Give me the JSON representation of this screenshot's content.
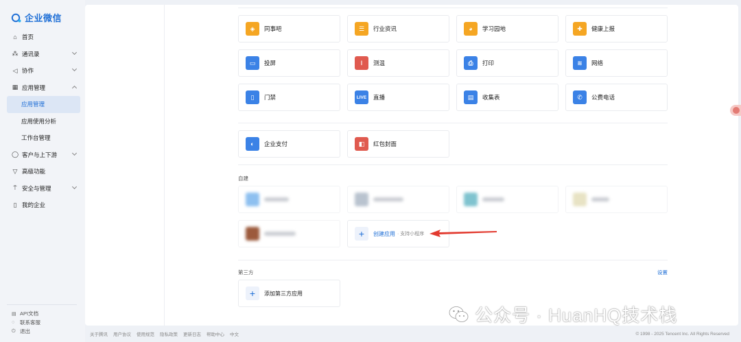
{
  "brand": {
    "name": "企业微信"
  },
  "sidebar": {
    "items": [
      {
        "label": "首页",
        "icon": "home-icon",
        "glyph": "⌂"
      },
      {
        "label": "通讯录",
        "icon": "contacts-icon",
        "glyph": "⁂",
        "expandable": true
      },
      {
        "label": "协作",
        "icon": "collab-icon",
        "glyph": "◁",
        "expandable": true
      },
      {
        "label": "应用管理",
        "icon": "apps-icon",
        "glyph": "▦",
        "expanded": true
      },
      {
        "label": "应用管理",
        "sub": true,
        "active": true
      },
      {
        "label": "应用使用分析",
        "sub": true
      },
      {
        "label": "工作台管理",
        "sub": true
      },
      {
        "label": "客户与上下游",
        "icon": "customer-icon",
        "glyph": "◯",
        "expandable": true
      },
      {
        "label": "高级功能",
        "icon": "advanced-icon",
        "glyph": "▽"
      },
      {
        "label": "安全与管理",
        "icon": "security-icon",
        "glyph": "⍑",
        "expandable": true
      },
      {
        "label": "我的企业",
        "icon": "enterprise-icon",
        "glyph": "▯"
      }
    ],
    "bottom_links": [
      {
        "label": "API文档",
        "icon": "doc-icon",
        "glyph": "▤"
      },
      {
        "label": "联系客服",
        "icon": "support-icon",
        "glyph": "◌"
      },
      {
        "label": "退出",
        "icon": "logout-icon",
        "glyph": "⏻"
      }
    ]
  },
  "apps": {
    "row1": [
      {
        "label": "同事吧",
        "icon": "colleague-icon",
        "color": "#f5a623",
        "glyph": "◈"
      },
      {
        "label": "行业资讯",
        "icon": "news-icon",
        "color": "#f5a623",
        "glyph": "☰"
      },
      {
        "label": "学习园地",
        "icon": "learning-icon",
        "color": "#f5a623",
        "glyph": "◕"
      },
      {
        "label": "健康上报",
        "icon": "health-icon",
        "color": "#f5a623",
        "glyph": "✚"
      }
    ],
    "row2": [
      {
        "label": "投屏",
        "icon": "screencast-icon",
        "color": "#3b82e6",
        "glyph": "▭"
      },
      {
        "label": "测温",
        "icon": "thermometer-icon",
        "color": "#e05a4f",
        "glyph": "ǀ"
      },
      {
        "label": "打印",
        "icon": "printer-icon",
        "color": "#3b82e6",
        "glyph": "⎙"
      },
      {
        "label": "网络",
        "icon": "wifi-icon",
        "color": "#3b82e6",
        "glyph": "≋"
      }
    ],
    "row3": [
      {
        "label": "门禁",
        "icon": "door-icon",
        "color": "#3b82e6",
        "glyph": "▯"
      },
      {
        "label": "直播",
        "icon": "live-icon",
        "color": "#3b82e6",
        "glyph": "LIVE"
      },
      {
        "label": "收集表",
        "icon": "form-icon",
        "color": "#3b82e6",
        "glyph": "▤"
      },
      {
        "label": "公费电话",
        "icon": "phone-icon",
        "color": "#3b82e6",
        "glyph": "✆"
      }
    ],
    "row4": [
      {
        "label": "企业支付",
        "icon": "payment-icon",
        "color": "#3b82e6",
        "glyph": "◐"
      },
      {
        "label": "红包封面",
        "icon": "redpacket-icon",
        "color": "#e05a4f",
        "glyph": "◧"
      }
    ]
  },
  "self_built": {
    "title": "自建",
    "create": {
      "label": "创建应用",
      "sub": "· 支持小程序"
    }
  },
  "third_party": {
    "title": "第三方",
    "settings": "设置",
    "add_label": "添加第三方应用"
  },
  "footer": {
    "links": [
      "关于腾讯",
      "用户协议",
      "使用规范",
      "隐私政策",
      "更新日志",
      "帮助中心",
      "中文"
    ],
    "copyright": "© 1998 - 2025 Tencent Inc. All Rights Reserved"
  },
  "watermark": {
    "text": "公众号 · HuanHQ技术栈"
  }
}
